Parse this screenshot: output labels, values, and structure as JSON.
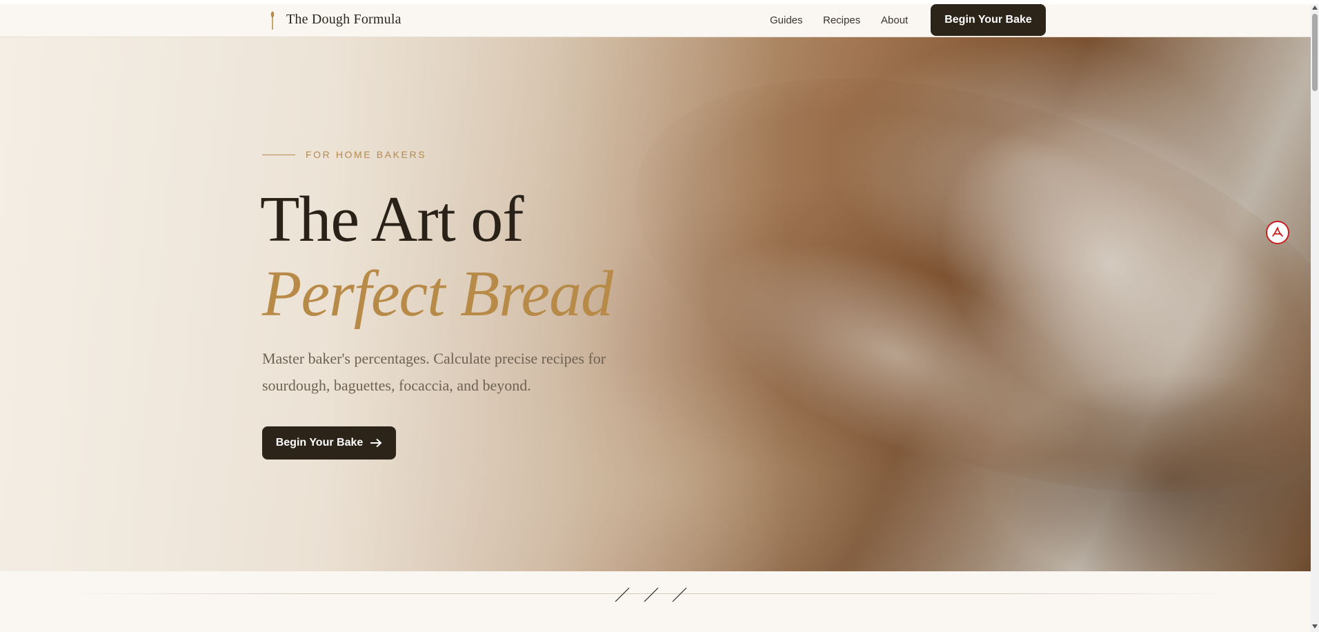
{
  "header": {
    "logo_text": "The Dough Formula",
    "nav_links": [
      "Guides",
      "Recipes",
      "About"
    ],
    "cta_label": "Begin Your Bake"
  },
  "hero": {
    "eyebrow": "FOR HOME BAKERS",
    "title_line1": "The Art of",
    "title_line2": "Perfect Bread",
    "subtitle": "Master baker's percentages. Calculate precise recipes for sourdough, baguettes, focaccia, and beyond.",
    "cta_label": "Begin Your Bake",
    "cta_icon": "arrow-right-icon"
  },
  "icons": {
    "logo": "wheat-stalk-icon",
    "floating_badge": "pdf-icon"
  },
  "colors": {
    "accent_gold": "#b88a48",
    "dark_brown": "#2c2419",
    "background": "#faf7f2"
  }
}
